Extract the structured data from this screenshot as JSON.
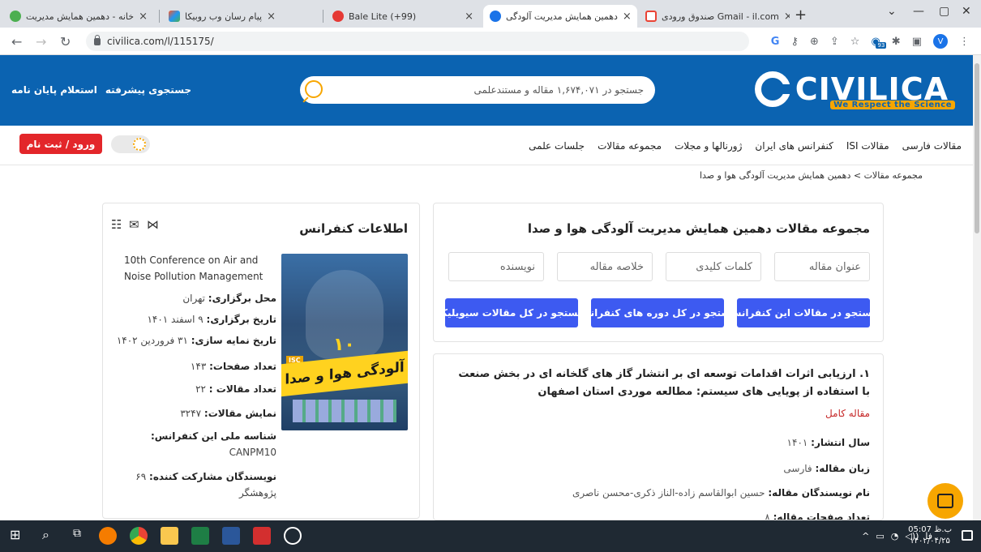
{
  "browser": {
    "tabs": [
      {
        "label": "خانه - دهمین همایش مدیریت",
        "fav_color": "#4caf50"
      },
      {
        "label": "پیام رسان وب روبیکا",
        "fav_color": "#ff5722"
      },
      {
        "label": "Bale Lite (+99)",
        "fav_color": "#e53935"
      },
      {
        "label": "دهمین همایش مدیریت آلودگی",
        "fav_color": "#1a73e8"
      },
      {
        "label": "صندوق ورودی Gmail - il.com",
        "fav_color": "#ea4335"
      }
    ],
    "url": "civilica.com/l/115175/",
    "profile_initial": "V",
    "ext_badge": "93"
  },
  "site": {
    "logo_text": "CIVILICA",
    "slogan": "We Respect the Science",
    "search_placeholder": "جستجو در ۱,۶۷۴,۰۷۱ مقاله و مستندعلمی",
    "header_links": [
      "جستجوی پیشرفته",
      "استعلام پایان نامه"
    ],
    "menu": [
      "مقالات فارسی",
      "مقالات ISI",
      "کنفرانس های ایران",
      "ژورنالها و مجلات",
      "مجموعه مقالات",
      "جلسات علمی"
    ],
    "login_label": "ورود / ثبت نام",
    "breadcrumb": "مجموعه مقالات > دهمین همایش مدیریت آلودگی هوا و صدا"
  },
  "conference": {
    "heading": "اطلاعات کنفرانس",
    "english_title": "10th Conference on Air and Noise Pollution Management",
    "poster_title": "آلودگی هوا و صدا",
    "poster_number": "۱۰",
    "poster_badge": "ISC",
    "rows": [
      {
        "label": "محل برگزاری:",
        "value": "تهران"
      },
      {
        "label": "تاریخ برگزاری:",
        "value": "۹ اسفند ۱۴۰۱"
      },
      {
        "label": "تاریخ نمایه سازی:",
        "value": "۳۱ فروردین ۱۴۰۲"
      },
      {
        "label": "تعداد صفحات:",
        "value": "۱۴۳"
      },
      {
        "label": "تعداد مقالات :",
        "value": "۲۲"
      },
      {
        "label": "نمایش مقالات:",
        "value": "۳۲۴۷"
      },
      {
        "label": "شناسه ملی این کنفرانس:",
        "value": ""
      },
      {
        "label": "",
        "value": "CANPM10"
      },
      {
        "label": "نویسندگان مشارکت کننده:",
        "value": "۶۹"
      },
      {
        "label": "",
        "value": "پژوهشگر"
      }
    ]
  },
  "search_panel": {
    "title": "مجموعه مقالات دهمین همایش مدیریت آلودگی هوا و صدا",
    "fields": [
      "عنوان مقاله",
      "کلمات کلیدی",
      "خلاصه مقاله",
      "نویسنده"
    ],
    "buttons": [
      "جستجو در مقالات این کنفرانس",
      "جستجو در کل دوره های کنفرانس",
      "جستجو در کل مقالات سیویلیکا"
    ]
  },
  "article": {
    "title": "۱. ارزیابی اثرات اقدامات توسعه ای بر انتشار گاز های گلخانه ای در بخش صنعت با استفاده از پویایی های سیستم: مطالعه موردی استان اصفهان",
    "type": "مقاله کامل",
    "rows": [
      {
        "label": "سال انتشار:",
        "value": "۱۴۰۱"
      },
      {
        "label": "زبان مقاله:",
        "value": "فارسی"
      },
      {
        "label": "نام نویسندگان مقاله:",
        "value": "حسین ابوالقاسم زاده-الناز ذکری-محسن ناصری"
      },
      {
        "label": "تعداد صفحات مقاله:",
        "value": "۸"
      }
    ]
  },
  "taskbar": {
    "time": "05:07 ب.ظ",
    "date": "۱۴۰۲/۰۴/۲۵",
    "lang": "فا"
  }
}
